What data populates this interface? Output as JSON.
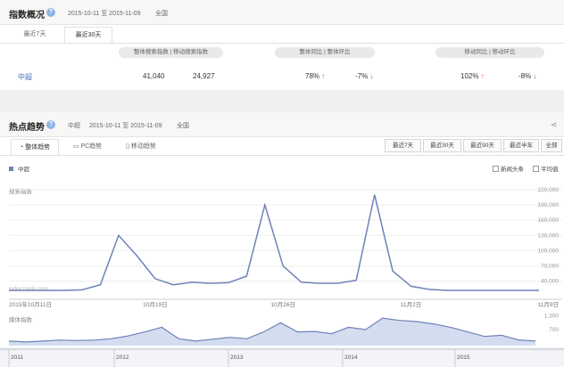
{
  "overview": {
    "title": "指数概况",
    "date_range": "2015-10-11 至 2015-11-09",
    "scope": "全国",
    "tabs": [
      {
        "label": "最近7天"
      },
      {
        "label": "最近30天"
      }
    ],
    "pills": {
      "overall_search": "整体搜索指数",
      "mobile_search": "移动搜索指数",
      "overall_yoy": "整体同比",
      "overall_mom": "整体环比",
      "mobile_yoy": "移动同比",
      "mobile_mom": "移动环比"
    },
    "keyword": "中超",
    "overall_index": "41,040",
    "mobile_index": "24,927",
    "overall_yoy": "78%",
    "overall_mom": "-7%",
    "mobile_yoy": "102%",
    "mobile_mom": "-8%"
  },
  "trend": {
    "title": "热点趋势",
    "keyword": "中超",
    "date_range": "2015-10-11 至 2015-11-09",
    "scope": "全国",
    "tabs": [
      {
        "label": "整体趋势"
      },
      {
        "label": "PC趋势"
      },
      {
        "label": "移动趋势"
      }
    ],
    "ranges": [
      "最近7天",
      "最近30天",
      "最近90天",
      "最近半年",
      "全部"
    ],
    "legend": "中超",
    "checkboxes": [
      "新闻头条",
      "平均值"
    ],
    "ylabel": "搜索指数",
    "watermark": "index.baidu.com",
    "media_label": "媒体指数",
    "colors": {
      "line": "#6e82b8",
      "area": "#c9d4ec"
    }
  },
  "chart_data": [
    {
      "type": "line",
      "ylabel": "搜索指数",
      "ylim": [
        15000,
        225000
      ],
      "yticks": [
        "220,000",
        "190,000",
        "160,000",
        "130,000",
        "100,000",
        "70,000",
        "40,000"
      ],
      "xticks": [
        "2015年10月11日",
        "10月19日",
        "10月26日",
        "11月2日",
        "11月9日"
      ],
      "series": [
        {
          "name": "中超",
          "values": [
            22000,
            22000,
            22000,
            22000,
            23000,
            33000,
            130000,
            90000,
            45000,
            33000,
            38000,
            36000,
            37000,
            50000,
            190000,
            70000,
            38000,
            36000,
            36000,
            42000,
            210000,
            60000,
            30000,
            24000,
            22000,
            22000,
            22000,
            22000,
            22000,
            22000
          ]
        }
      ],
      "grid": true,
      "legend_position": "top-left"
    },
    {
      "type": "area",
      "ylabel": "媒体指数",
      "ylim": [
        0,
        1400
      ],
      "yticks": [
        "1,300",
        "700"
      ],
      "xticks": [
        "2011",
        "2012",
        "2013",
        "2014",
        "2015"
      ],
      "series": [
        {
          "name": "中超",
          "values": [
            200,
            160,
            200,
            240,
            220,
            240,
            300,
            420,
            600,
            800,
            300,
            200,
            280,
            360,
            300,
            600,
            1000,
            600,
            620,
            520,
            800,
            700,
            1200,
            1100,
            1050,
            950,
            800,
            600,
            400,
            450,
            250,
            200
          ]
        }
      ]
    }
  ]
}
